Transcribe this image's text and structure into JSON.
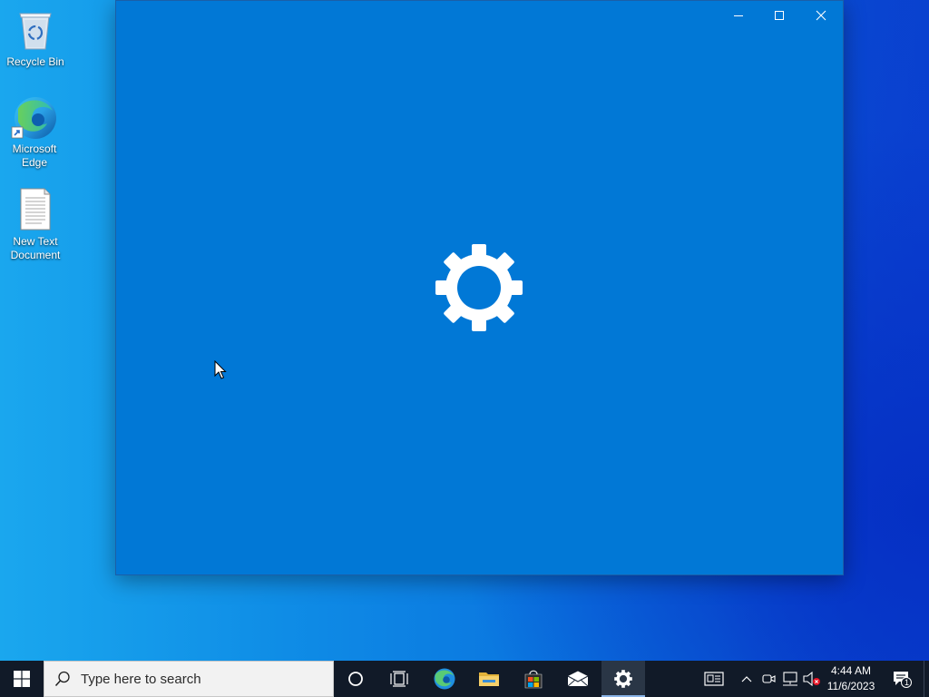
{
  "desktop": {
    "icons": [
      {
        "label": "Recycle Bin",
        "icon": "recycle-bin-icon"
      },
      {
        "label": "Microsoft\nEdge",
        "icon": "edge-icon"
      },
      {
        "label": "New Text\nDocument",
        "icon": "text-file-icon"
      }
    ]
  },
  "window": {
    "background": "#0178d6",
    "controls": [
      "minimize-icon",
      "maximize-icon",
      "close-icon"
    ],
    "splash_icon": "gear-icon"
  },
  "taskbar": {
    "start_icon": "windows-logo-icon",
    "search_placeholder": "Type here to search",
    "pinned": [
      "cortana-icon",
      "task-view-icon",
      "edge-icon",
      "file-explorer-icon",
      "store-icon",
      "mail-icon",
      "settings-icon"
    ],
    "active_app": "settings-icon",
    "tray": [
      "news-icon",
      "chevron-up-icon",
      "meet-now-icon",
      "network-icon",
      "volume-muted-icon"
    ],
    "time": "4:44 AM",
    "date": "11/6/2023",
    "notification_count": "1"
  },
  "colors": {
    "window_blue": "#0178d6",
    "taskbar": "#111a28"
  }
}
